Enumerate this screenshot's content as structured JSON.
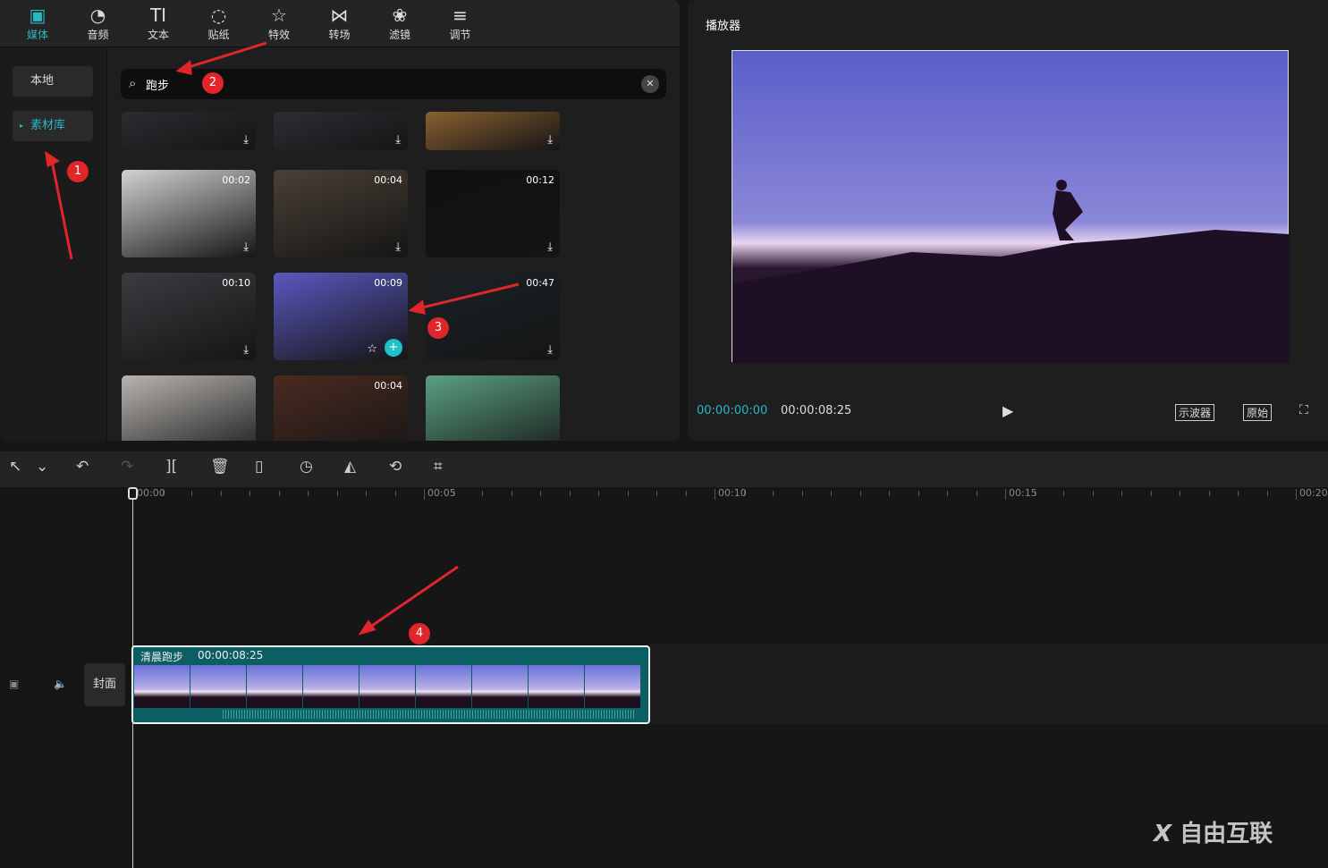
{
  "tabs": [
    {
      "label": "媒体",
      "icon": "media-icon"
    },
    {
      "label": "音频",
      "icon": "audio-icon"
    },
    {
      "label": "文本",
      "icon": "text-icon"
    },
    {
      "label": "贴纸",
      "icon": "sticker-icon"
    },
    {
      "label": "特效",
      "icon": "effects-icon"
    },
    {
      "label": "转场",
      "icon": "transition-icon"
    },
    {
      "label": "滤镜",
      "icon": "filter-icon"
    },
    {
      "label": "调节",
      "icon": "adjust-icon"
    }
  ],
  "sidebar": {
    "local": "本地",
    "library": "素材库"
  },
  "search": {
    "value": "跑步"
  },
  "thumbs": [
    {
      "dur": "",
      "bg": "#2a2c30"
    },
    {
      "dur": "",
      "bg": "#2c2e34"
    },
    {
      "dur": "",
      "bg": "#8a6030"
    },
    {
      "dur": "00:02",
      "bg": "#d0d2d4"
    },
    {
      "dur": "00:04",
      "bg": "#4a4036"
    },
    {
      "dur": "00:12",
      "bg": "#101010"
    },
    {
      "dur": "00:10",
      "bg": "#3a3c40"
    },
    {
      "dur": "00:09",
      "bg": "#5a58c0"
    },
    {
      "dur": "00:47",
      "bg": "#1a2226"
    },
    {
      "dur": "",
      "bg": "#b8b4b0"
    },
    {
      "dur": "00:04",
      "bg": "#4a2a20"
    },
    {
      "dur": "",
      "bg": "#5aa080"
    }
  ],
  "player": {
    "title": "播放器",
    "current_time": "00:00:00:00",
    "total_time": "00:00:08:25",
    "scope_btn": "示波器",
    "original_btn": "原始"
  },
  "ruler": [
    "00:00",
    "00:05",
    "00:10",
    "00:15",
    "00:20"
  ],
  "track": {
    "cover": "封面",
    "clip_name": "清晨跑步",
    "clip_duration": "00:00:08:25"
  },
  "annotations": [
    "1",
    "2",
    "3",
    "4"
  ],
  "watermark": "自由互联",
  "colors": {
    "accent": "#2ab6c6",
    "annotation": "#e0262a"
  }
}
